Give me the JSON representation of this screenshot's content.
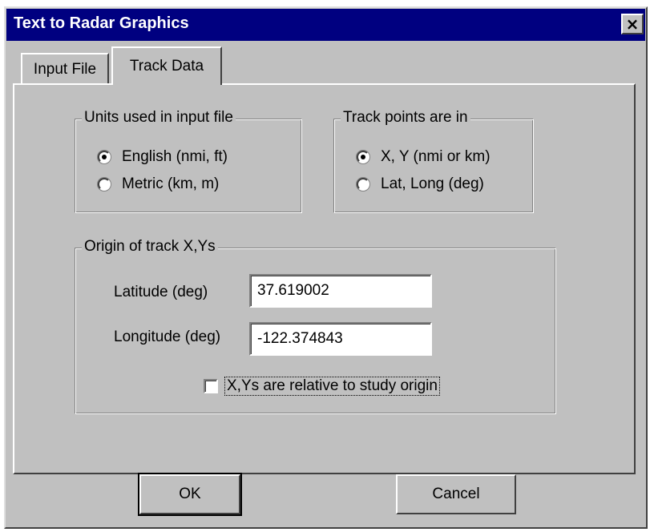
{
  "window": {
    "title": "Text to Radar Graphics",
    "close_icon": "×"
  },
  "tabs": [
    {
      "label": "Input File",
      "active": false
    },
    {
      "label": "Track Data",
      "active": true
    }
  ],
  "units_group": {
    "legend": "Units used in input file",
    "options": [
      {
        "label": "English (nmi, ft)",
        "checked": true
      },
      {
        "label": "Metric (km, m)",
        "checked": false
      }
    ]
  },
  "points_group": {
    "legend": "Track points are in",
    "options": [
      {
        "label": "X, Y (nmi or km)",
        "checked": true
      },
      {
        "label": "Lat, Long (deg)",
        "checked": false
      }
    ]
  },
  "origin_group": {
    "legend": "Origin of track X,Ys",
    "latitude_label": "Latitude (deg)",
    "latitude_value": "37.619002",
    "longitude_label": "Longitude (deg)",
    "longitude_value": "-122.374843",
    "relative_checkbox_label": "X,Ys are relative to study origin",
    "relative_checked": false
  },
  "buttons": {
    "ok": "OK",
    "cancel": "Cancel"
  }
}
